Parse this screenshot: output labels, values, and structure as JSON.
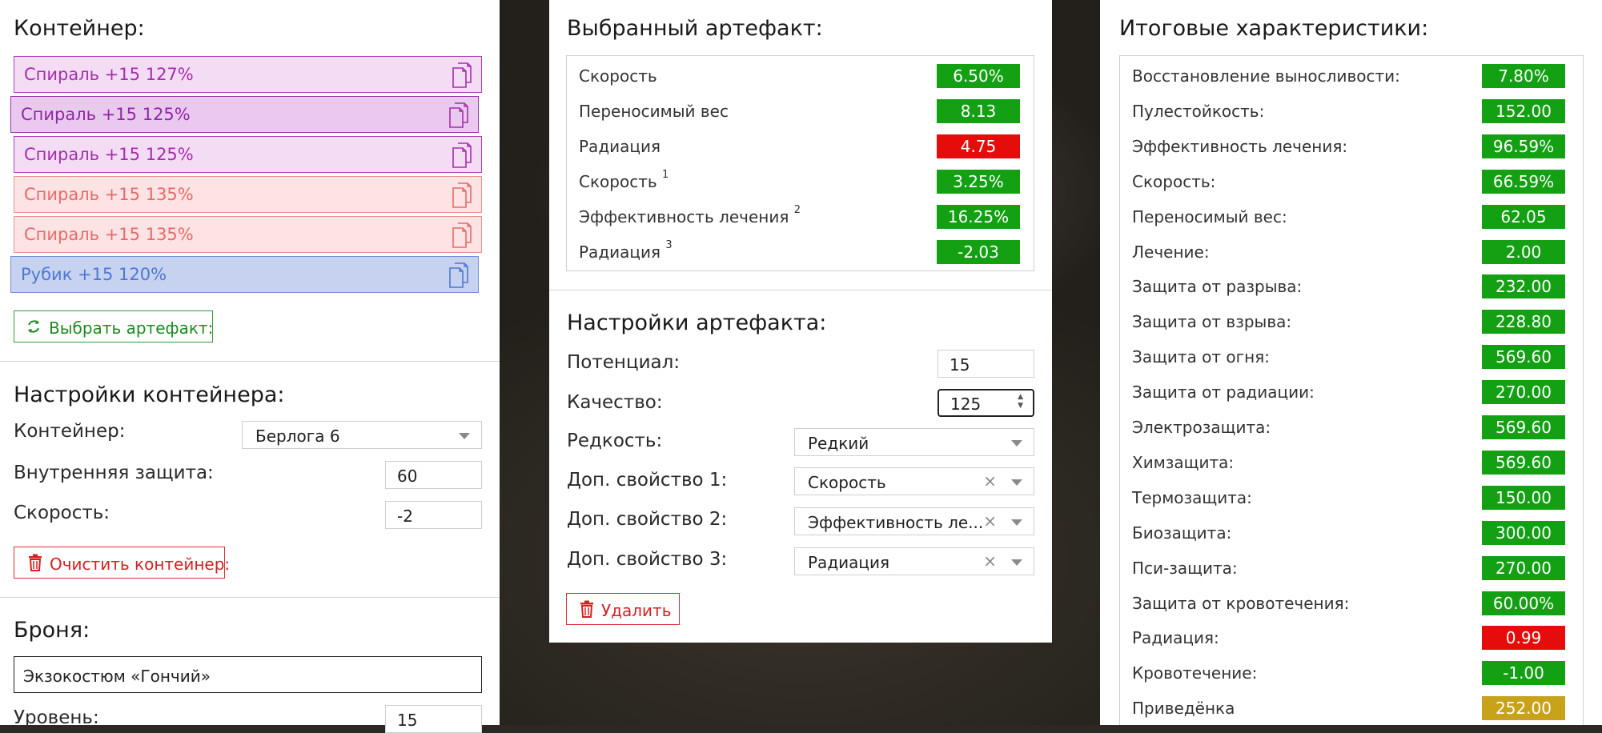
{
  "left": {
    "container_title": "Контейнер:",
    "artifacts": [
      {
        "name": "Спираль +15 127%",
        "style": "purple",
        "icon": "copy-icon"
      },
      {
        "name": "Спираль +15 125%",
        "style": "purple-d",
        "icon": "copy-icon"
      },
      {
        "name": "Спираль +15 125%",
        "style": "purple",
        "icon": "copy-icon"
      },
      {
        "name": "Спираль +15 135%",
        "style": "pink",
        "icon": "copy-icon"
      },
      {
        "name": "Спираль +15 135%",
        "style": "pink",
        "icon": "copy-icon"
      },
      {
        "name": "Рубик +15 120%",
        "style": "blue",
        "icon": "copy-icon"
      }
    ],
    "select_artifact_label": "Выбрать артефакт:",
    "settings_title": "Настройки контейнера:",
    "container_label": "Контейнер:",
    "container_value": "Берлога 6",
    "inner_protection_label": "Внутренняя защита:",
    "inner_protection_value": "60",
    "speed_label": "Скорость:",
    "speed_value": "-2",
    "clear_label": "Очистить контейнер:",
    "armor_title": "Броня:",
    "armor_value": "Экзокостюм «Гончий»",
    "level_label": "Уровень:",
    "level_value": "15"
  },
  "middle": {
    "selected_title": "Выбранный артефакт:",
    "stats": [
      {
        "label": "Скорость",
        "sup": "",
        "value": "6.50%",
        "color": "green"
      },
      {
        "label": "Переносимый вес",
        "sup": "",
        "value": "8.13",
        "color": "green"
      },
      {
        "label": "Радиация",
        "sup": "",
        "value": "4.75",
        "color": "red"
      },
      {
        "label": "Скорость",
        "sup": "1",
        "value": "3.25%",
        "color": "green"
      },
      {
        "label": "Эффективность лечения",
        "sup": "2",
        "value": "16.25%",
        "color": "green"
      },
      {
        "label": "Радиация",
        "sup": "3",
        "value": "-2.03",
        "color": "green"
      }
    ],
    "settings_title": "Настройки артефакта:",
    "potential_label": "Потенциал:",
    "potential_value": "15",
    "quality_label": "Качество:",
    "quality_value": "125",
    "rarity_label": "Редкость:",
    "rarity_value": "Редкий",
    "prop1_label": "Доп. свойство 1:",
    "prop1_value": "Скорость",
    "prop2_label": "Доп. свойство 2:",
    "prop2_value": "Эффективность ле...",
    "prop3_label": "Доп. свойство 3:",
    "prop3_value": "Радиация",
    "delete_label": "Удалить",
    "clear_symbol": "×"
  },
  "right": {
    "title": "Итоговые характеристики:",
    "stats": [
      {
        "label": "Восстановление выносливости:",
        "value": "7.80%",
        "color": "green"
      },
      {
        "label": "Пулестойкость:",
        "value": "152.00",
        "color": "green"
      },
      {
        "label": "Эффективность лечения:",
        "value": "96.59%",
        "color": "green"
      },
      {
        "label": "Скорость:",
        "value": "66.59%",
        "color": "green"
      },
      {
        "label": "Переносимый вес:",
        "value": "62.05",
        "color": "green"
      },
      {
        "label": "Лечение:",
        "value": "2.00",
        "color": "green"
      },
      {
        "label": "Защита от разрыва:",
        "value": "232.00",
        "color": "green"
      },
      {
        "label": "Защита от взрыва:",
        "value": "228.80",
        "color": "green"
      },
      {
        "label": "Защита от огня:",
        "value": "569.60",
        "color": "green"
      },
      {
        "label": "Защита от радиации:",
        "value": "270.00",
        "color": "green"
      },
      {
        "label": "Электрозащита:",
        "value": "569.60",
        "color": "green"
      },
      {
        "label": "Химзащита:",
        "value": "569.60",
        "color": "green"
      },
      {
        "label": "Термозащита:",
        "value": "150.00",
        "color": "green"
      },
      {
        "label": "Биозащита:",
        "value": "300.00",
        "color": "green"
      },
      {
        "label": "Пси-защита:",
        "value": "270.00",
        "color": "green"
      },
      {
        "label": "Защита от кровотечения:",
        "value": "60.00%",
        "color": "green"
      },
      {
        "label": "Радиация:",
        "value": "0.99",
        "color": "red"
      },
      {
        "label": "Кровотечение:",
        "value": "-1.00",
        "color": "green"
      },
      {
        "label": "Приведёнка",
        "value": "252.00",
        "color": "gold"
      }
    ]
  },
  "colors": {
    "green": "#13a013",
    "red": "#e60c0c",
    "gold": "#c8a21a",
    "purple": "#a42eae",
    "pink": "#e66a6a",
    "blue": "#4d79d3"
  }
}
